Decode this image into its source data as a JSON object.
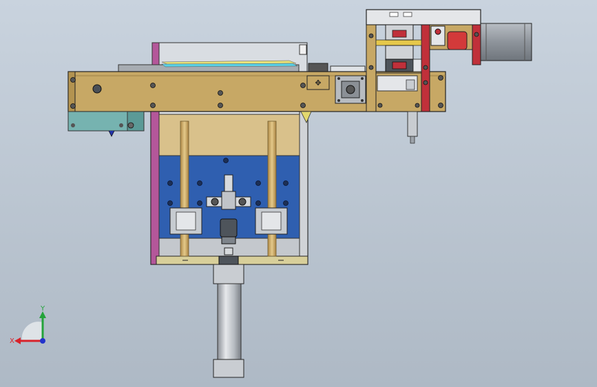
{
  "viewport": {
    "background_top": "#c9d3de",
    "background_bottom": "#aeb9c5"
  },
  "triad": {
    "x_label": "X",
    "y_label": "Y",
    "x_color": "#d8222a",
    "y_color": "#23a33a",
    "z_color": "#2233cc"
  },
  "colors": {
    "brass": "#c7a865",
    "brass_dark": "#9c8045",
    "magenta": "#b4579a",
    "red": "#c0303a",
    "blue_plate": "#2f5fb0",
    "teal": "#76b3b0",
    "steel": "#c8ccd1",
    "motor": "#9da3aa"
  }
}
